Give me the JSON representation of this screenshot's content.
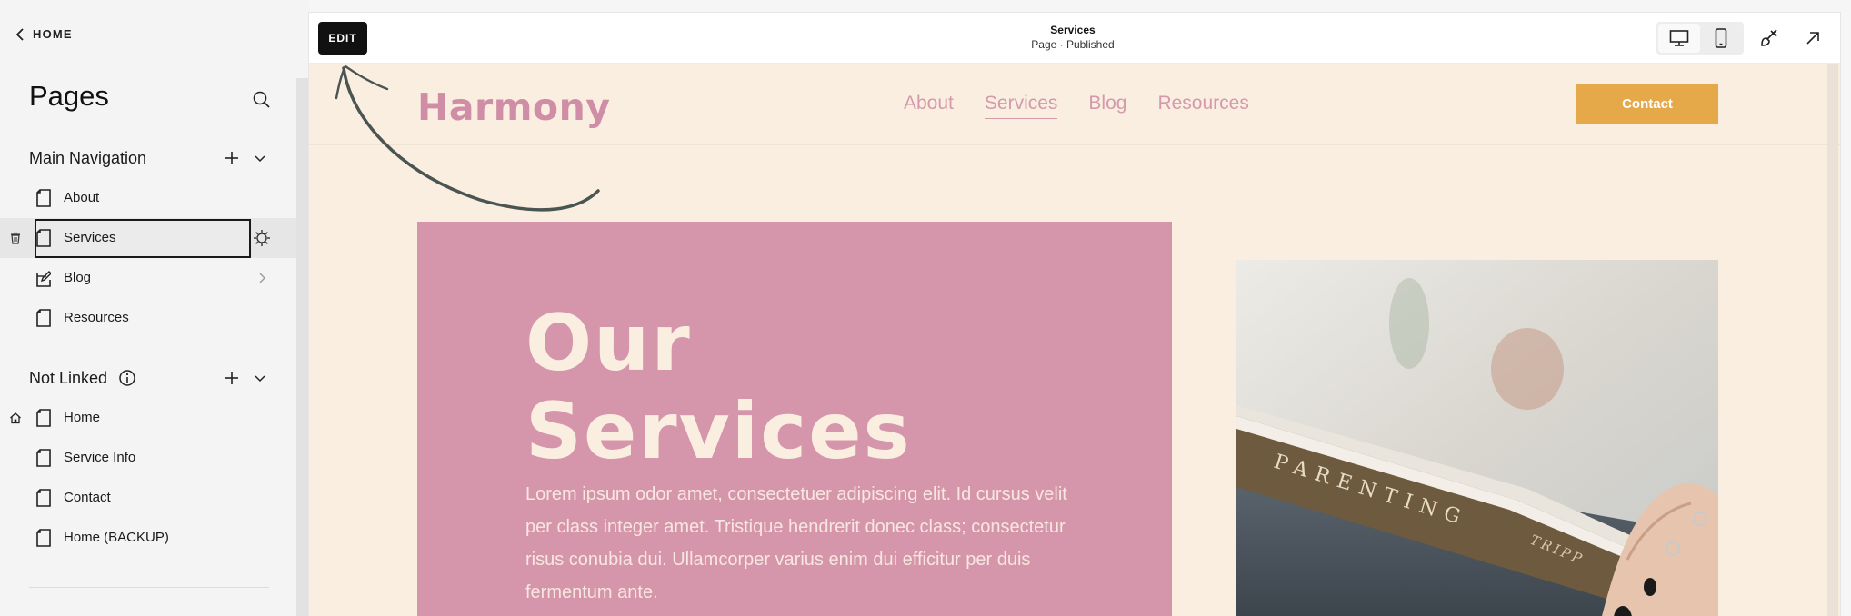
{
  "sidebar": {
    "back_label": "HOME",
    "title": "Pages",
    "main_nav": {
      "label": "Main Navigation",
      "items": [
        {
          "label": "About"
        },
        {
          "label": "Services"
        },
        {
          "label": "Blog"
        },
        {
          "label": "Resources"
        }
      ]
    },
    "not_linked": {
      "label": "Not Linked",
      "items": [
        {
          "label": "Home"
        },
        {
          "label": "Service Info"
        },
        {
          "label": "Contact"
        },
        {
          "label": "Home (BACKUP)"
        }
      ]
    }
  },
  "toolbar": {
    "edit_label": "EDIT",
    "page_name": "Services",
    "page_status": "Page · Published"
  },
  "site": {
    "logo": "Harmony",
    "nav": [
      "About",
      "Services",
      "Blog",
      "Resources"
    ],
    "current_nav": "Services",
    "contact_label": "Contact",
    "hero_title_line1": "Our",
    "hero_title_line2": "Services",
    "hero_body": "Lorem ipsum odor amet, consectetuer adipiscing elit. Id cursus velit per class integer amet. Tristique hendrerit donec class; consectetur risus conubia dui. Ullamcorper varius enim dui efficitur per duis fermentum ante.",
    "book_spine_text": "PARENTING",
    "book_author_text": "TRIPP"
  },
  "colors": {
    "page_bg": "#faeee1",
    "accent_pink": "#d595ab",
    "logo_pink": "#cf8ea5",
    "contact_orange": "#e6a94a"
  },
  "icons": {
    "back": "chevron-left-icon",
    "search": "search-icon",
    "add": "plus-icon",
    "collapse": "chevron-down-icon",
    "page": "page-icon",
    "blog": "blog-icon",
    "home": "home-icon",
    "trash": "trash-icon",
    "settings": "gear-icon",
    "info": "info-icon",
    "desktop": "desktop-icon",
    "mobile": "mobile-icon",
    "design": "paintbrush-icon",
    "exit": "expand-arrow-icon"
  }
}
